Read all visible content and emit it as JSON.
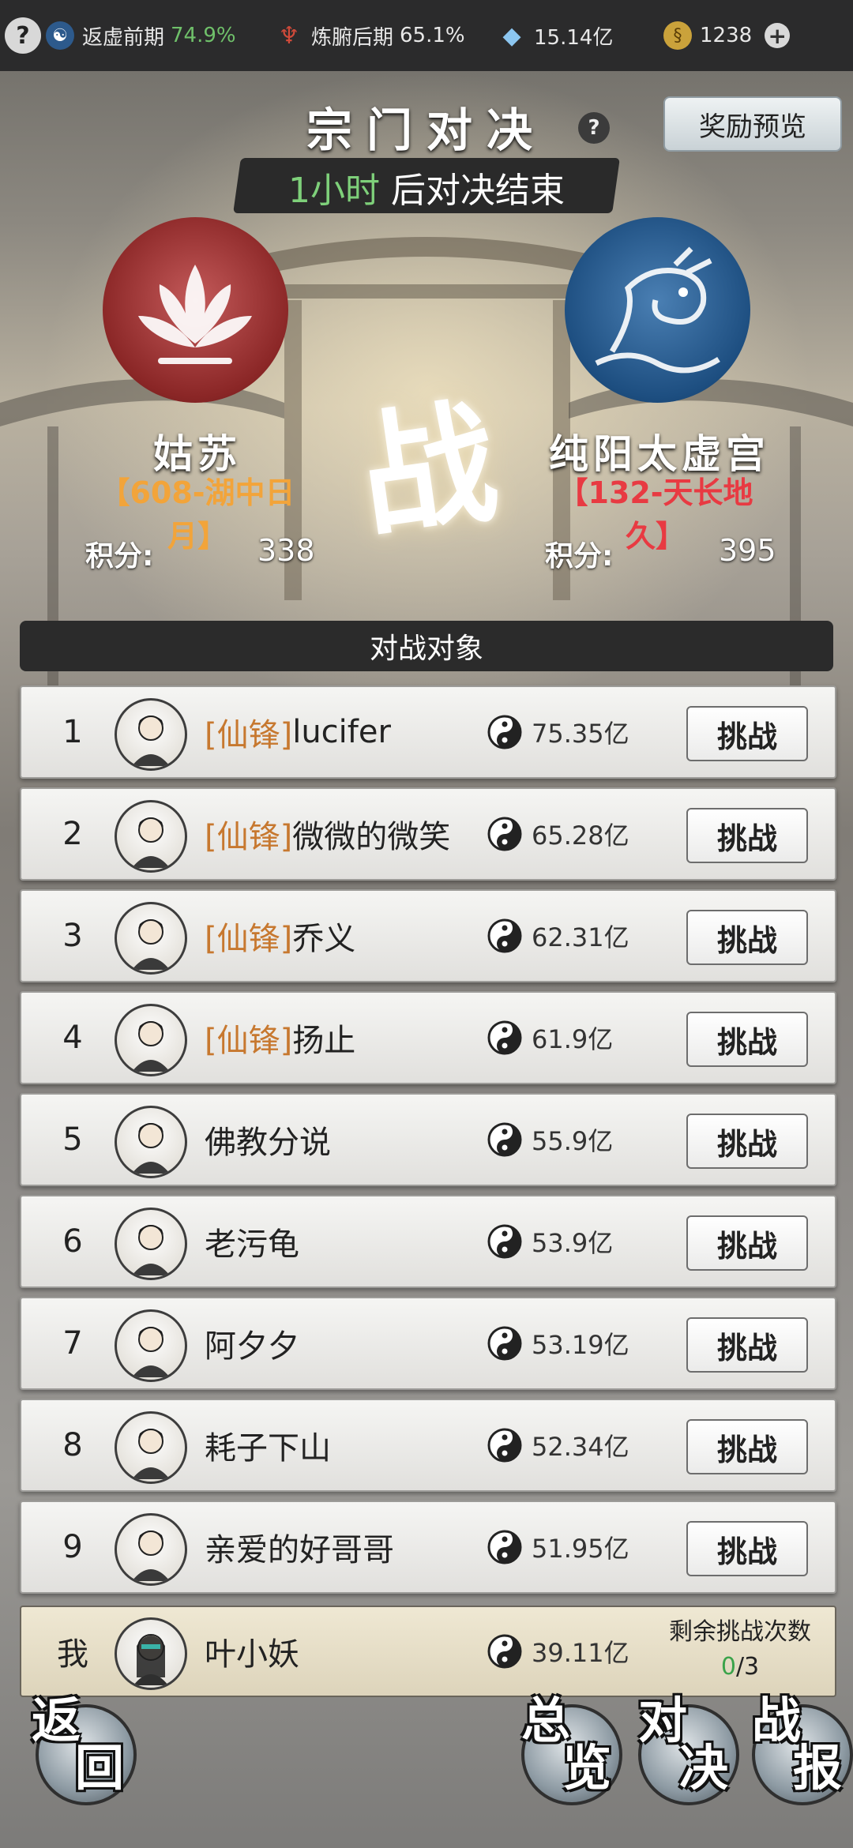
{
  "topbar": {
    "help_icon": "question-icon",
    "realm1": {
      "icon": "taiji-icon",
      "label": "返虚前期",
      "pct": "74.9%"
    },
    "realm2": {
      "icon": "trident-icon",
      "label": "炼腑后期",
      "pct": "65.1%"
    },
    "crystal": {
      "icon": "crystal-icon",
      "value": "15.14亿"
    },
    "coin": {
      "icon": "coin-icon",
      "value": "1238"
    },
    "plus_icon": "plus-icon"
  },
  "header": {
    "title": "宗门对决",
    "reward_preview": "奖励预览",
    "timer_highlight": "1小时",
    "timer_suffix": "后对决结束"
  },
  "battle": {
    "vs_glyph": "战",
    "left": {
      "emblem": "lotus-emblem-icon",
      "name": "姑苏",
      "server": "【608-湖中日月】",
      "score_label": "积分:",
      "score": "338"
    },
    "right": {
      "emblem": "dragon-emblem-icon",
      "name": "纯阳太虚宫",
      "server": "【132-天长地久】",
      "score_label": "积分:",
      "score": "395"
    }
  },
  "opponents": {
    "header": "对战对象",
    "challenge_label": "挑战",
    "rows": [
      {
        "rank": "1",
        "tag": "[仙锋]",
        "name": "lucifer",
        "power": "75.35亿"
      },
      {
        "rank": "2",
        "tag": "[仙锋]",
        "name": "微微的微笑",
        "power": "65.28亿"
      },
      {
        "rank": "3",
        "tag": "[仙锋]",
        "name": "乔义",
        "power": "62.31亿"
      },
      {
        "rank": "4",
        "tag": "[仙锋]",
        "name": "扬止",
        "power": "61.9亿"
      },
      {
        "rank": "5",
        "tag": "",
        "name": "佛教分说",
        "power": "55.9亿"
      },
      {
        "rank": "6",
        "tag": "",
        "name": "老污龟",
        "power": "53.9亿"
      },
      {
        "rank": "7",
        "tag": "",
        "name": "阿夕夕",
        "power": "53.19亿"
      },
      {
        "rank": "8",
        "tag": "",
        "name": "耗子下山",
        "power": "52.34亿"
      },
      {
        "rank": "9",
        "tag": "",
        "name": "亲爱的好哥哥",
        "power": "51.95亿"
      }
    ]
  },
  "me": {
    "rank": "我",
    "name": "叶小妖",
    "power": "39.11亿",
    "remain_label": "剩余挑战次数",
    "remain_used": "0",
    "remain_total": "/3"
  },
  "bottom": {
    "back": [
      "返",
      "回"
    ],
    "overview": [
      "总",
      "览"
    ],
    "duel": [
      "对",
      "决"
    ],
    "report": [
      "战",
      "报"
    ]
  }
}
